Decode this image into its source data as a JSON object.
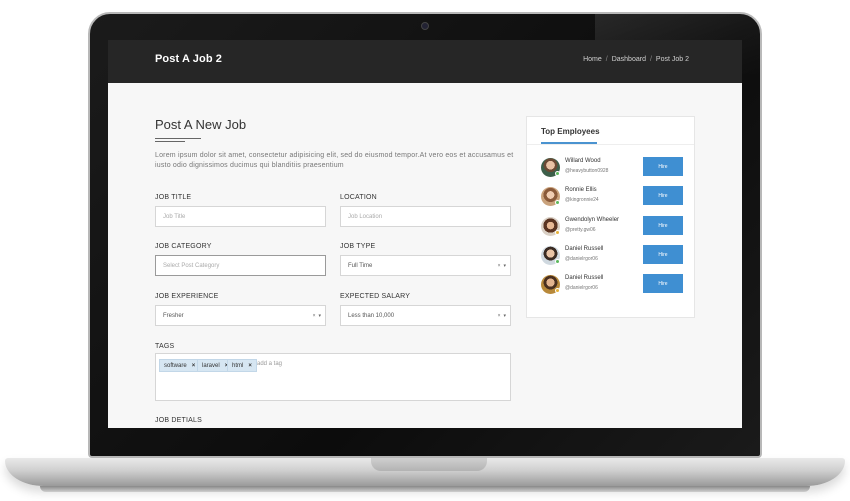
{
  "header": {
    "title": "Post A Job 2",
    "breadcrumb": [
      "Home",
      "Dashboard",
      "Post Job 2"
    ]
  },
  "form": {
    "title": "Post A New Job",
    "description": "Lorem ipsum dolor sit amet, consectetur adipisicing elit, sed do eiusmod tempor.At vero eos et accusamus et iusto odio dignissimos ducimus qui blanditiis praesentium",
    "job_title": {
      "label": "JOB TITLE",
      "placeholder": "Job Title"
    },
    "location": {
      "label": "LOCATION",
      "placeholder": "Job Location"
    },
    "job_category": {
      "label": "JOB CATEGORY",
      "placeholder": "Select Post Category"
    },
    "job_type": {
      "label": "JOB TYPE",
      "value": "Full Time"
    },
    "job_experience": {
      "label": "JOB EXPERIENCE",
      "value": "Fresher"
    },
    "expected_salary": {
      "label": "EXPECTED SALARY",
      "value": "Less than 10,000"
    },
    "tags": {
      "label": "TAGS",
      "items": [
        "software",
        "laravel",
        "html"
      ],
      "placeholder": "add a tag"
    },
    "job_details_label": "JOB DETIALS"
  },
  "top_employees": {
    "title": "Top Employees",
    "hire_label": "Hire",
    "items": [
      {
        "name": "Willard Wood",
        "handle": "@heavybutton0928",
        "status_color": "#5cb85c"
      },
      {
        "name": "Ronnie Ellis",
        "handle": "@kingronnie24",
        "status_color": "#5cb85c"
      },
      {
        "name": "Gwendolyn Wheeler",
        "handle": "@pretty.gw06",
        "status_color": "#e6b23a"
      },
      {
        "name": "Daniel Russell",
        "handle": "@danielrgor06",
        "status_color": "#5cb85c"
      },
      {
        "name": "Daniel Russell",
        "handle": "@danielrgor06",
        "status_color": "#e6b23a"
      }
    ]
  },
  "colors": {
    "topbar": "#262626",
    "accent": "#3f8fd2"
  }
}
